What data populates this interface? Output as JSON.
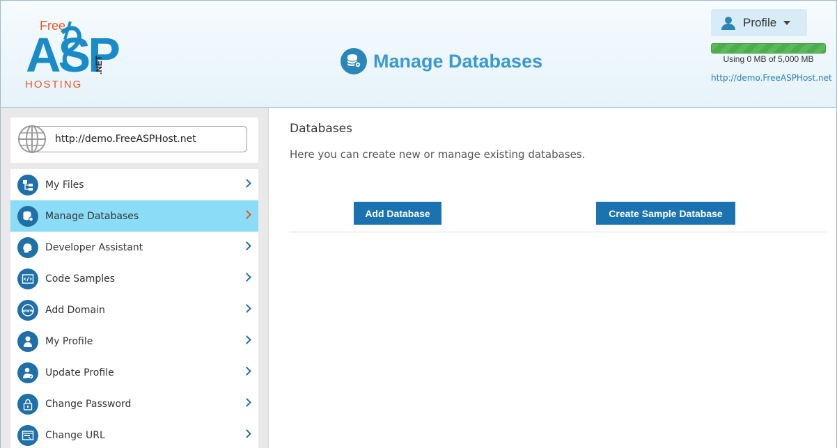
{
  "header": {
    "logo": {
      "free": "Free",
      "asp": "ASP",
      "hosting": "HOSTING",
      "net": ".NET"
    },
    "page_title": "Manage Databases",
    "profile_label": "Profile",
    "usage": {
      "text": "Using 0 MB of 5,000 MB",
      "fraction": 1.0
    },
    "site_link": "http://demo.FreeASPHost.net"
  },
  "sidebar": {
    "url_value": "http://demo.FreeASPHost.net",
    "items": [
      {
        "label": "My Files",
        "icon": "folder-tree-icon",
        "active": false
      },
      {
        "label": "Manage Databases",
        "icon": "database-gear-icon",
        "active": true
      },
      {
        "label": "Developer Assistant",
        "icon": "head-brain-icon",
        "active": false
      },
      {
        "label": "Code Samples",
        "icon": "code-window-icon",
        "active": false
      },
      {
        "label": "Add Domain",
        "icon": "www-globe-icon",
        "active": false
      },
      {
        "label": "My Profile",
        "icon": "user-icon",
        "active": false
      },
      {
        "label": "Update Profile",
        "icon": "user-edit-icon",
        "active": false
      },
      {
        "label": "Change Password",
        "icon": "lock-icon",
        "active": false
      },
      {
        "label": "Change URL",
        "icon": "browser-url-icon",
        "active": false
      }
    ]
  },
  "main": {
    "section_title": "Databases",
    "description": "Here you can create new or manage existing databases.",
    "add_button": "Add Database",
    "sample_button": "Create Sample Database"
  },
  "colors": {
    "accent": "#1a72b0",
    "active_item": "#8adcf7",
    "brand_orange": "#e8552a",
    "title_blue": "#3a9acf"
  }
}
